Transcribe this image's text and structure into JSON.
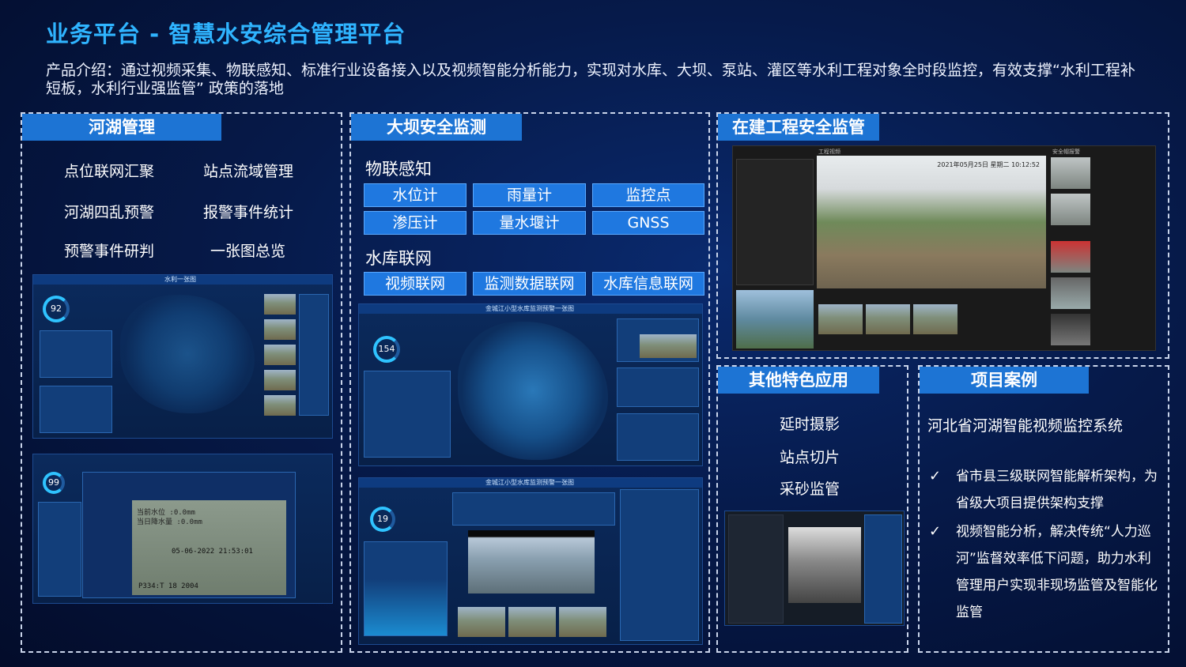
{
  "title": "业务平台 - 智慧水安综合管理平台",
  "intro": "产品介绍：通过视频采集、物联感知、标准行业设备接入以及视频智能分析能力，实现对水库、大坝、泵站、灌区等水利工程对象全时段监控，有效支撑“水利工程补短板，水利行业强监管” 政策的落地",
  "hehu": {
    "header": "河湖管理",
    "features": [
      "点位联网汇聚",
      "站点流域管理",
      "河湖四乱预警",
      "报警事件统计",
      "预警事件研判",
      "一张图总览"
    ],
    "screen1_title": "水利一张图",
    "ring_value": "92",
    "screen2_ring": "99",
    "video_overlay_1": "当前水位 :0.0mm",
    "video_overlay_2": "当日降水量 :0.0mm",
    "video_timestamp": "05-06-2022 21:53:01",
    "video_code": "P334:T 18 2004"
  },
  "daba": {
    "header": "大坝安全监测",
    "iot_label": "物联感知",
    "iot_buttons": [
      "水位计",
      "雨量计",
      "监控点",
      "渗压计",
      "量水堰计",
      "GNSS"
    ],
    "res_label": "水库联网",
    "res_buttons": [
      "视频联网",
      "监测数据联网",
      "水库信息联网"
    ],
    "screen_title": "金城江小型水库监测预警一张图",
    "ring1": "154",
    "ring2": "19"
  },
  "zaijian": {
    "header": "在建工程安全监管",
    "timestamp": "2021年05月25日 星期二 10:12:52",
    "panel_title": "工程视频",
    "right_title": "安全帽报警"
  },
  "other": {
    "header": "其他特色应用",
    "items": [
      "延时摄影",
      "站点切片",
      "采砂监管"
    ]
  },
  "cases": {
    "header": "项目案例",
    "name": "河北省河湖智能视频监控系统",
    "check": "✓",
    "points": [
      [
        "省市县三级联网智能解析架构，为",
        "省级大项目提供架构支撑"
      ],
      [
        "视频智能分析，解决传统“人力巡",
        "河”监督效率低下问题，助力水利",
        "管理用户实现非现场监管及智能化",
        "监管"
      ]
    ]
  },
  "colors": {
    "accent": "#1d74d4",
    "title": "#2fb4ff",
    "background": "#061a4a"
  }
}
